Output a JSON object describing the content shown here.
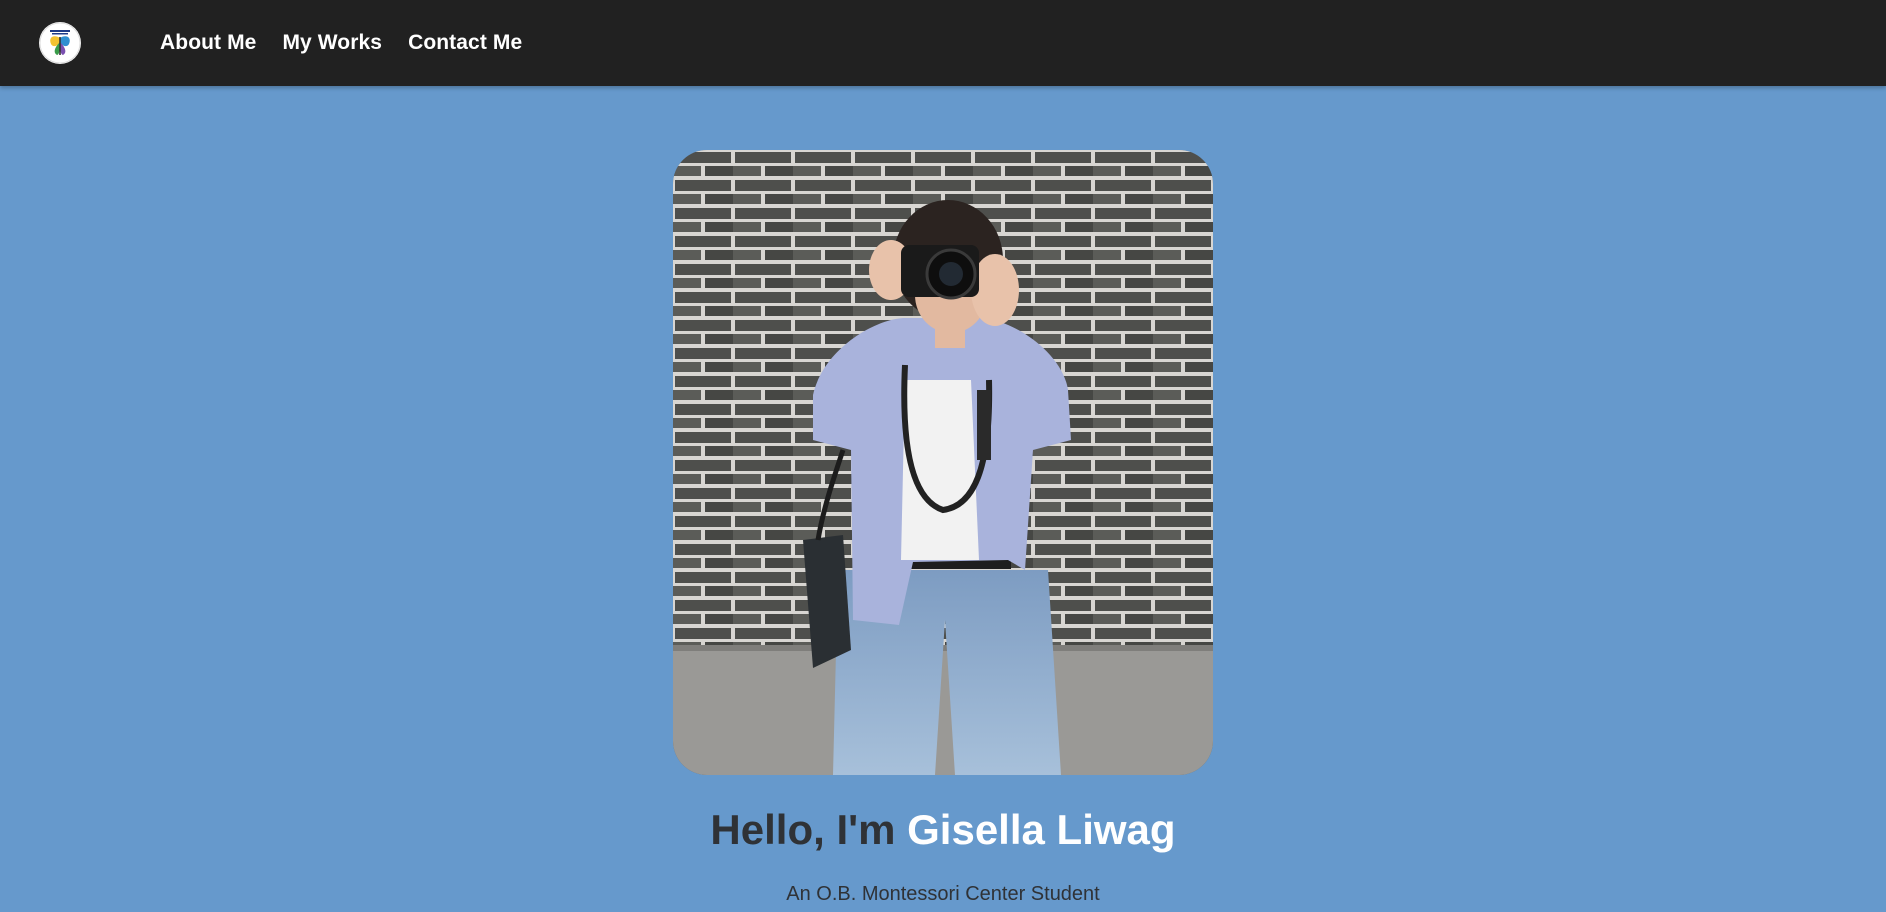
{
  "nav": {
    "logo_icon": "butterfly-school-logo-icon",
    "links": [
      "About Me",
      "My Works",
      "Contact Me"
    ]
  },
  "hero": {
    "photo_alt": "Portrait of a student holding a camera in front of a brick wall",
    "greeting": "Hello, I'm ",
    "name": "Gisella Liwag",
    "subtitle": "An O.B. Montessori Center Student"
  },
  "colors": {
    "page_background": "#6699cc",
    "navbar_background": "#212121",
    "nav_text": "#ffffff",
    "headline_dark": "#2f3236",
    "headline_highlight": "#ffffff"
  }
}
